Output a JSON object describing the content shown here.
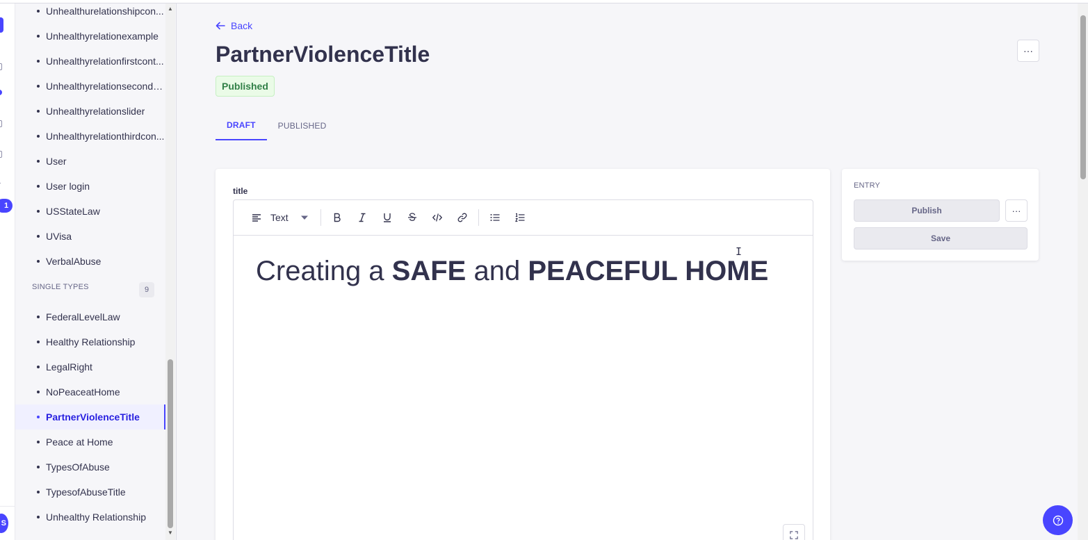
{
  "sidebar": {
    "collection_items": [
      "Unhealthurelationshipcon...",
      "Unhealthyrelationexample",
      "Unhealthyrelationfirstcont...",
      "Unhealthyrelationsecondc...",
      "Unhealthyrelationslider",
      "Unhealthyrelationthirdcon...",
      "User",
      "User login",
      "USStateLaw",
      "UVisa",
      "VerbalAbuse"
    ],
    "single_types_title": "SINGLE TYPES",
    "single_types_count": "9",
    "single_items": [
      "FederalLevelLaw",
      "Healthy Relationship",
      "LegalRight",
      "NoPeaceatHome",
      "PartnerViolenceTitle",
      "Peace at Home",
      "TypesOfAbuse",
      "TypesofAbuseTitle",
      "Unhealthy Relationship"
    ],
    "active_item": "PartnerViolenceTitle"
  },
  "rail": {
    "badge_count": "1",
    "avatar_initial": "S"
  },
  "header": {
    "back_label": "Back",
    "title": "PartnerViolenceTitle",
    "status": "Published",
    "more_label": "···"
  },
  "tabs": [
    {
      "label": "DRAFT",
      "active": true
    },
    {
      "label": "PUBLISHED",
      "active": false
    }
  ],
  "editor": {
    "field_label": "title",
    "block_type": "Text",
    "content": {
      "part1": "Creating a ",
      "bold1": "SAFE",
      "part2": " and ",
      "bold2": "PEACEFUL HOME"
    }
  },
  "entry_panel": {
    "title": "ENTRY",
    "publish_label": "Publish",
    "more_label": "···",
    "save_label": "Save"
  },
  "colors": {
    "primary": "#4945ff",
    "success_bg": "#eafbe7",
    "success_text": "#328048"
  }
}
